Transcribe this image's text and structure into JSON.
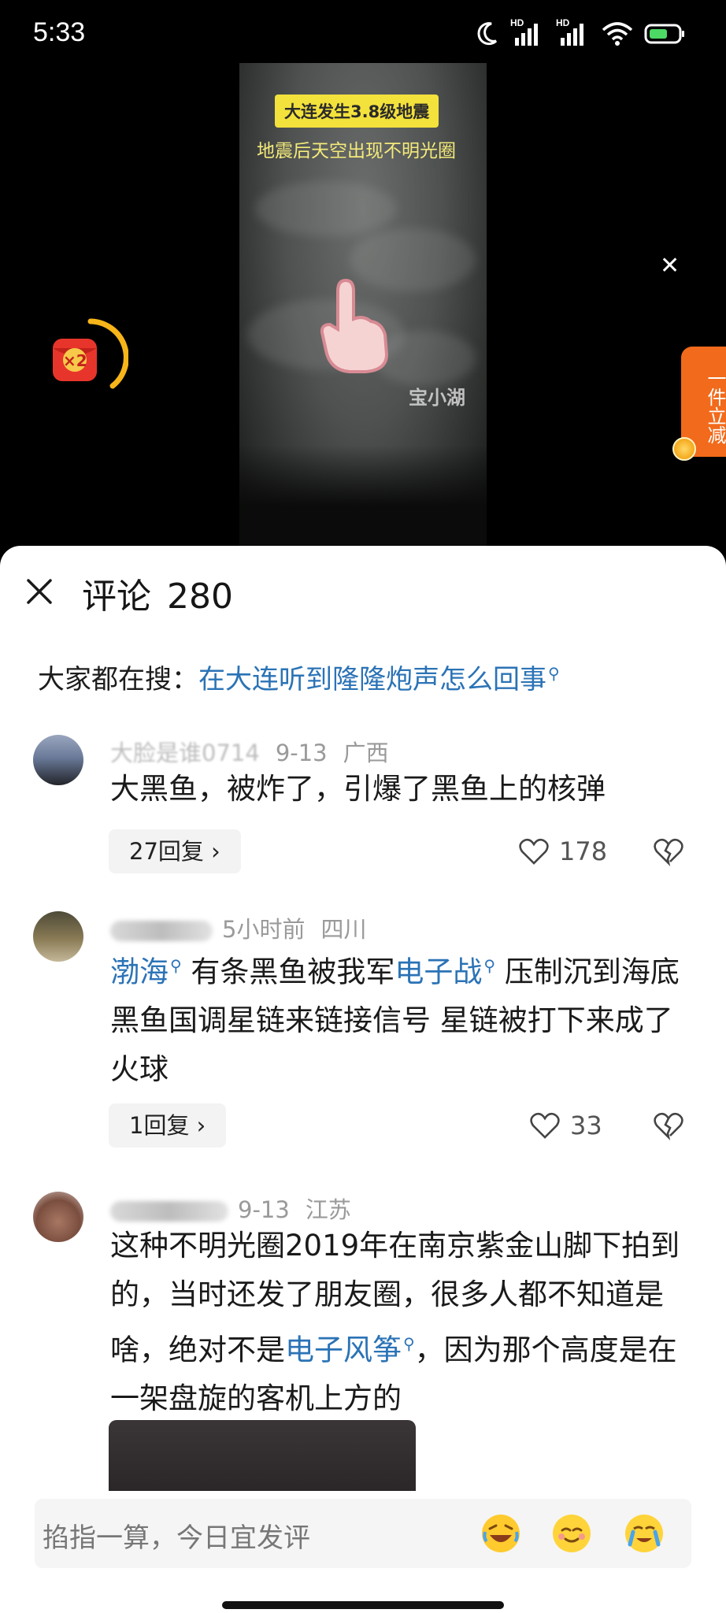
{
  "status_bar": {
    "time": "5:33",
    "hd_1": "HD",
    "hd_2": "HD"
  },
  "video": {
    "title": "大连发生3.8级地震",
    "subtitle": "地震后天空出现不明光圈",
    "watermark": "宝小湖",
    "reward_badge": "×2",
    "promo_tab": "一件立减"
  },
  "comments_panel": {
    "title": "评论",
    "count": "280",
    "search_prefix": "大家都在搜：",
    "search_link": "在大连听到隆隆炮声怎么回事"
  },
  "comments": [
    {
      "name": "大脸是谁0714",
      "date": "9-13",
      "location": "广西",
      "text": "大黑鱼，被炸了，引爆了黑鱼上的核弹",
      "replies": "27回复",
      "likes": "178"
    },
    {
      "date": "5小时前",
      "location": "四川",
      "text_link_1": "渤海",
      "text_part_1": " 有条黑鱼被我军",
      "text_link_2": "电子战",
      "text_part_2": " 压制沉到海底 黑鱼国调星链来链接信号 星链被打下来成了火球",
      "replies": "1回复",
      "likes": "33"
    },
    {
      "date": "9-13",
      "location": "江苏",
      "text_part_1": "这种不明光圈2019年在南京紫金山脚下拍到的，当时还发了朋友圈，很多人都不知道是啥，绝对不是",
      "text_link_1": "电子风筝",
      "text_part_2": "，因为那个高度是在一架盘旋的客机上方的"
    }
  ],
  "input": {
    "placeholder": "掐指一算，今日宜发评"
  },
  "colors": {
    "link": "#2b73b6",
    "promo": "#f26a1b",
    "title_badge": "#f3e13c"
  }
}
